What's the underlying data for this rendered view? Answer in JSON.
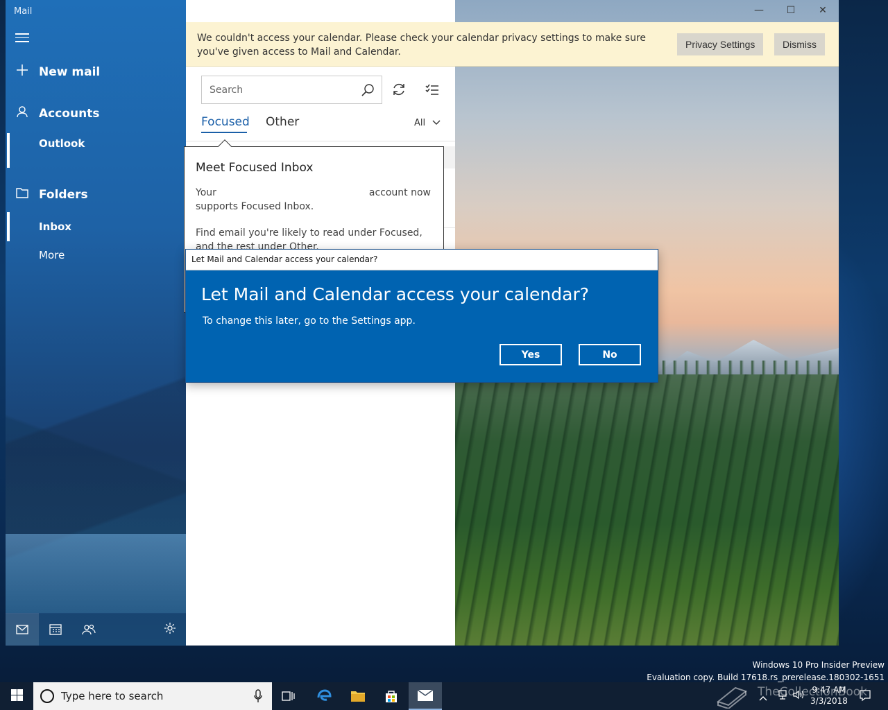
{
  "window": {
    "app_title": "Mail",
    "controls": {
      "minimize": "—",
      "maximize": "☐",
      "close": "✕"
    }
  },
  "nav": {
    "new_mail": "New mail",
    "accounts": "Accounts",
    "account_item": "Outlook",
    "folders": "Folders",
    "inbox": "Inbox",
    "more": "More"
  },
  "banner": {
    "message": "We couldn't access your calendar.  Please check your calendar privacy settings to make sure you've given access to Mail and Calendar.",
    "privacy_button": "Privacy Settings",
    "dismiss_button": "Dismiss"
  },
  "list": {
    "search_placeholder": "Search",
    "tabs": [
      {
        "label": "Focused",
        "active": true
      },
      {
        "label": "Other",
        "active": false
      }
    ],
    "filter": "All"
  },
  "tip": {
    "title": "Meet Focused Inbox",
    "line1_start": "Your",
    "line1_end": "account now",
    "line1_cont": "supports Focused Inbox.",
    "body": "Find email you're likely to read under Focused, and the rest under Other."
  },
  "dialog": {
    "window_title": "Let Mail and Calendar access your calendar?",
    "heading": "Let Mail and Calendar access your calendar?",
    "subtext": "To change this later, go to the Settings app.",
    "yes": "Yes",
    "no": "No"
  },
  "desktop": {
    "watermark_line1": "Windows 10 Pro Insider Preview",
    "watermark_line2": "Evaluation copy. Build 17618.rs_prerelease.180302-1651"
  },
  "taskbar": {
    "search_placeholder": "Type here to search",
    "time": "9:47 AM",
    "date": "3/3/2018"
  },
  "brand_overlay": "TheCollectionBook",
  "colors": {
    "accent": "#0063b1",
    "nav": "#1f6fb8",
    "banner": "#fcf3d2",
    "focused_tab": "#1a5fa8"
  }
}
